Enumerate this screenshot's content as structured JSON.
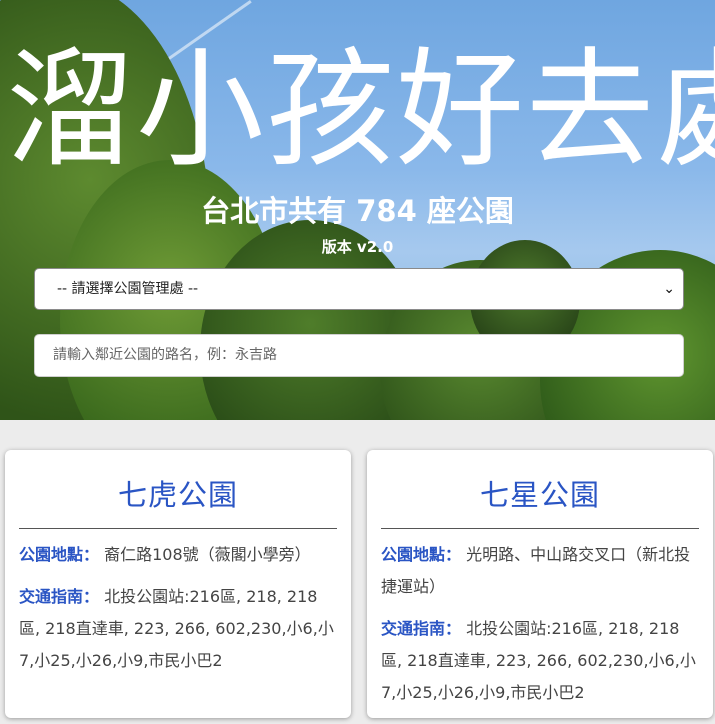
{
  "hero": {
    "title": "溜小孩好去處",
    "subtitle": "台北市共有 784 座公園",
    "version": "版本 v2.0"
  },
  "select": {
    "value": "-- 請選擇公園管理處 --"
  },
  "search": {
    "placeholder": "請輸入鄰近公園的路名，例：永吉路"
  },
  "cards": [
    {
      "name": "七虎公園",
      "location_label": "公園地點：",
      "location": "裔仁路108號（薇閣小學旁）",
      "transit_label": "交通指南：",
      "transit": "北投公園站:216區, 218, 218區, 218直達車, 223, 266, 602,230,小6,小7,小25,小26,小9,市民小巴2"
    },
    {
      "name": "七星公園",
      "location_label": "公園地點：",
      "location": "光明路、中山路交叉口（新北投捷運站）",
      "transit_label": "交通指南：",
      "transit": "北投公園站:216區, 218, 218區, 218直達車, 223, 266, 602,230,小6,小7,小25,小26,小9,市民小巴2"
    }
  ]
}
